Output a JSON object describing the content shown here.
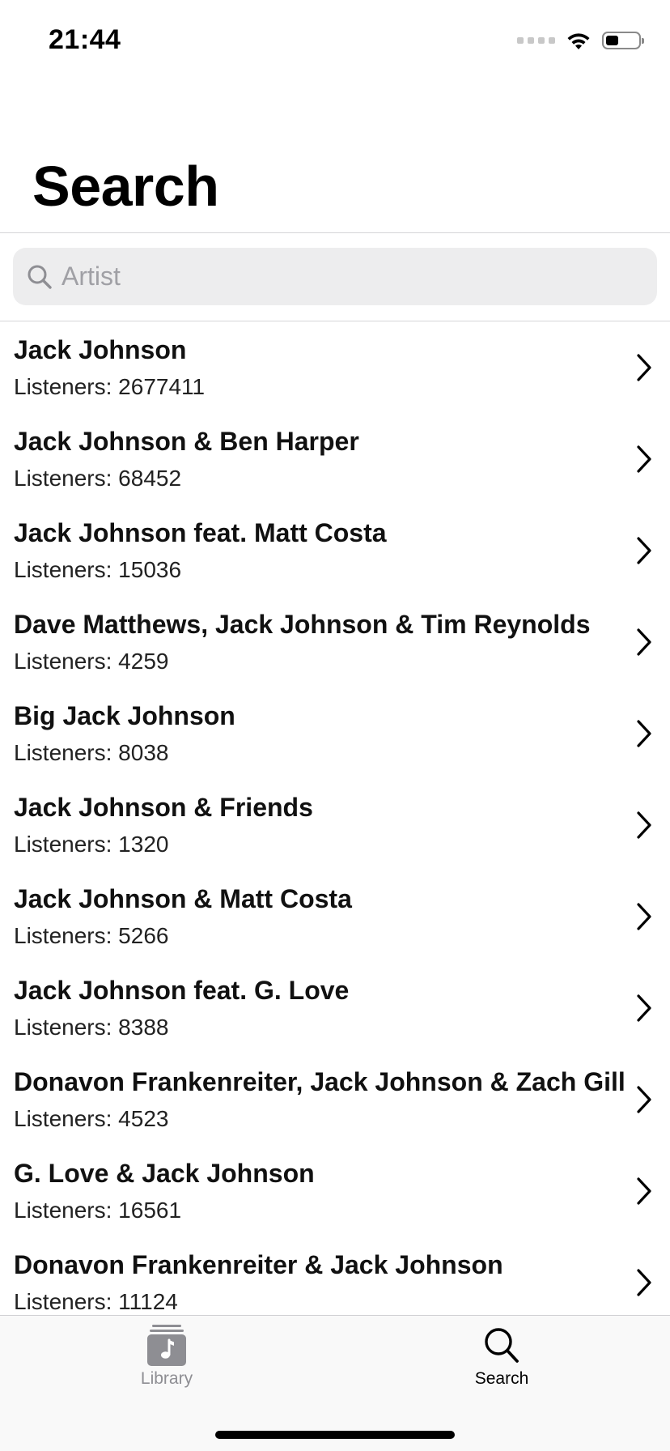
{
  "status_bar": {
    "time": "21:44",
    "icons": [
      "cellular-signal-icon",
      "wifi-icon",
      "battery-icon"
    ],
    "battery_level": 0.4
  },
  "header": {
    "title": "Search"
  },
  "search": {
    "placeholder": "Artist",
    "value": "",
    "icon": "magnifying-glass-icon"
  },
  "results": [
    {
      "name": "Jack Johnson",
      "listeners": "Listeners: 2677411"
    },
    {
      "name": "Jack Johnson & Ben Harper",
      "listeners": "Listeners: 68452"
    },
    {
      "name": "Jack Johnson feat. Matt Costa",
      "listeners": "Listeners: 15036"
    },
    {
      "name": "Dave Matthews, Jack Johnson & Tim Reynolds",
      "listeners": "Listeners: 4259"
    },
    {
      "name": "Big Jack Johnson",
      "listeners": "Listeners: 8038"
    },
    {
      "name": "Jack Johnson & Friends",
      "listeners": "Listeners: 1320"
    },
    {
      "name": "Jack Johnson & Matt Costa",
      "listeners": "Listeners: 5266"
    },
    {
      "name": "Jack Johnson feat. G. Love",
      "listeners": "Listeners: 8388"
    },
    {
      "name": "Donavon Frankenreiter, Jack Johnson & Zach Gill",
      "listeners": "Listeners: 4523"
    },
    {
      "name": "G. Love & Jack Johnson",
      "listeners": "Listeners: 16561"
    },
    {
      "name": "Donavon Frankenreiter & Jack Johnson",
      "listeners": "Listeners: 11124"
    }
  ],
  "tab_bar": {
    "tabs": [
      {
        "label": "Library",
        "icon": "music-library-icon",
        "selected": false
      },
      {
        "label": "Search",
        "icon": "search-icon",
        "selected": true
      }
    ]
  },
  "colors": {
    "background": "#ffffff",
    "search_field": "#ededee",
    "placeholder": "#a0a0a5",
    "tab_inactive": "#8e8e93",
    "tab_active": "#000000"
  }
}
